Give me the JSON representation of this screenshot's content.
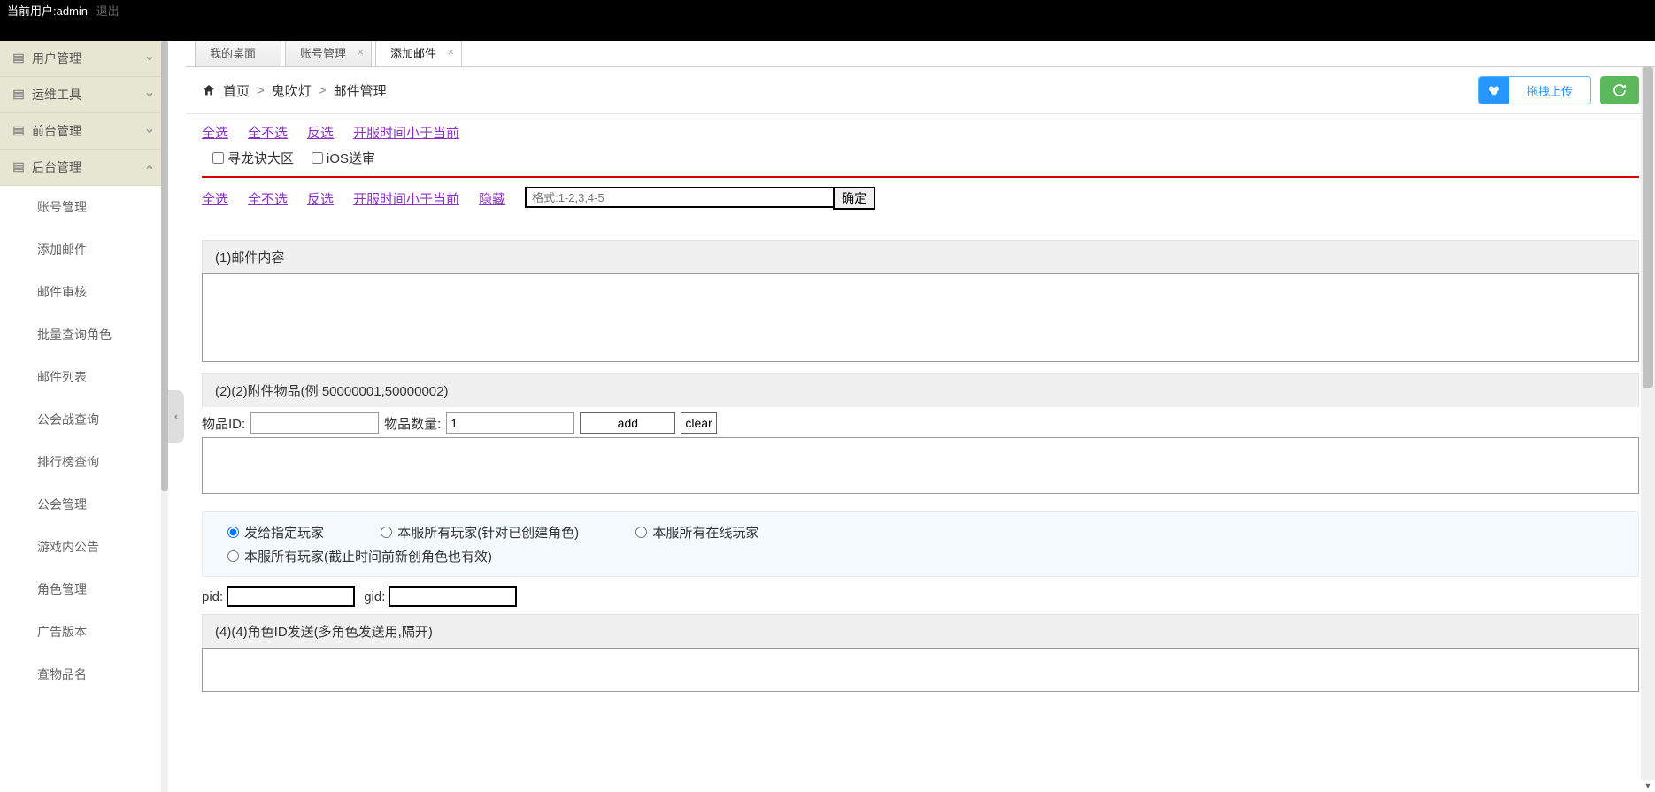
{
  "topbar": {
    "user_prefix": "当前用户:",
    "user": "admin",
    "logout": "退出"
  },
  "sidebar": {
    "groups": [
      {
        "label": "用户管理",
        "expanded": false
      },
      {
        "label": "运维工具",
        "expanded": false
      },
      {
        "label": "前台管理",
        "expanded": false
      },
      {
        "label": "后台管理",
        "expanded": true
      }
    ],
    "sub_items": [
      {
        "label": "账号管理"
      },
      {
        "label": "添加邮件"
      },
      {
        "label": "邮件审核"
      },
      {
        "label": "批量查询角色"
      },
      {
        "label": "邮件列表"
      },
      {
        "label": "公会战查询"
      },
      {
        "label": "排行榜查询"
      },
      {
        "label": "公会管理"
      },
      {
        "label": "游戏内公告"
      },
      {
        "label": "角色管理"
      },
      {
        "label": "广告版本"
      },
      {
        "label": "查物品名"
      }
    ]
  },
  "tabs": [
    {
      "label": "我的桌面",
      "closable": false,
      "active": false
    },
    {
      "label": "账号管理",
      "closable": true,
      "active": false
    },
    {
      "label": "添加邮件",
      "closable": true,
      "active": true
    }
  ],
  "breadcrumb": {
    "home": "首页",
    "mid": "鬼吹灯",
    "tail": "邮件管理"
  },
  "crumb_actions": {
    "upload": "拖拽上传"
  },
  "selection": {
    "all": "全选",
    "none": "全不选",
    "invert": "反选",
    "time_lt_now": "开服时间小于当前",
    "check1": "寻龙诀大区",
    "check2": "iOS送审",
    "hide": "隐藏",
    "filter_placeholder": "格式:1-2,3,4-5",
    "confirm": "确定"
  },
  "mail": {
    "section1_title": "(1)邮件内容",
    "section2_title": "(2)(2)附件物品(例 50000001,50000002)",
    "item_id_label": "物品ID:",
    "item_qty_label": "物品数量:",
    "item_qty_value": "1",
    "add": "add",
    "clear": "clear"
  },
  "target": {
    "opt1": "发给指定玩家",
    "opt2": "本服所有玩家(针对已创建角色)",
    "opt3": "本服所有在线玩家",
    "opt4": "本服所有玩家(截止时间前新创角色也有效)",
    "pid_label": "pid:",
    "gid_label": "gid:",
    "section4_title": "(4)(4)角色ID发送(多角色发送用,隔开)"
  }
}
